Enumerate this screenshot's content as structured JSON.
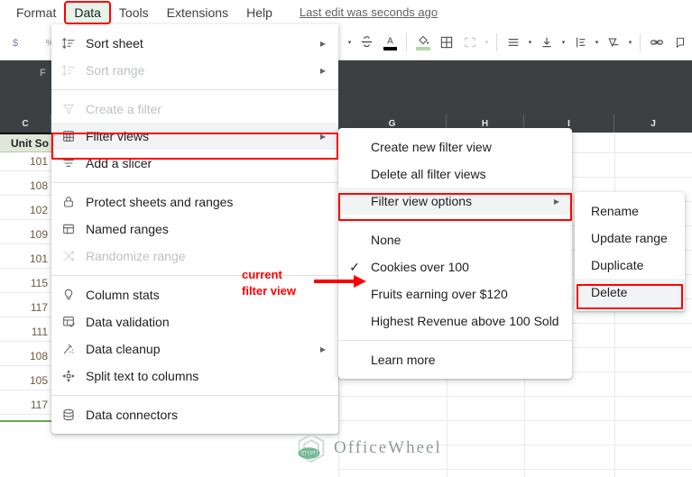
{
  "menubar": {
    "items": [
      {
        "label": "Format",
        "active": false
      },
      {
        "label": "Data",
        "active": true
      },
      {
        "label": "Tools",
        "active": false
      },
      {
        "label": "Extensions",
        "active": false
      },
      {
        "label": "Help",
        "active": false
      }
    ],
    "last_edit": "Last edit was seconds ago"
  },
  "toolbar": {
    "left_icons": [
      "currency-icon",
      "percent-icon",
      "decrease-decimal-icon"
    ],
    "right_icons": [
      "strikethrough-icon",
      "text-color-icon",
      "fill-color-icon",
      "borders-icon",
      "merge-cells-icon",
      "horizontal-align-icon",
      "vertical-align-icon",
      "text-wrap-icon",
      "text-rotation-icon",
      "insert-link-icon",
      "insert-comment-icon"
    ]
  },
  "sheet": {
    "formula_label": "F",
    "column_headers": [
      "C",
      "G",
      "H",
      "I",
      "J"
    ],
    "column_c": {
      "header": "Unit So",
      "values": [
        "101",
        "108",
        "102",
        "109",
        "101",
        "115",
        "117",
        "111",
        "108",
        "105",
        "117"
      ]
    }
  },
  "data_menu": {
    "items": [
      {
        "label": "Sort sheet",
        "icon": "sort-icon",
        "submenu": true,
        "disabled": false,
        "highlighted": false
      },
      {
        "label": "Sort range",
        "icon": "sort-icon",
        "submenu": true,
        "disabled": true,
        "highlighted": false
      },
      {
        "divider": true
      },
      {
        "label": "Create a filter",
        "icon": "filter-icon",
        "submenu": false,
        "disabled": true,
        "highlighted": false
      },
      {
        "label": "Filter views",
        "icon": "filter-views-icon",
        "submenu": true,
        "disabled": false,
        "highlighted": true,
        "boxed": true
      },
      {
        "label": "Add a slicer",
        "icon": "slicer-icon",
        "submenu": false,
        "disabled": false,
        "highlighted": false
      },
      {
        "divider": true
      },
      {
        "label": "Protect sheets and ranges",
        "icon": "lock-icon",
        "submenu": false,
        "disabled": false,
        "highlighted": false
      },
      {
        "label": "Named ranges",
        "icon": "named-ranges-icon",
        "submenu": false,
        "disabled": false,
        "highlighted": false
      },
      {
        "label": "Randomize range",
        "icon": "randomize-icon",
        "submenu": false,
        "disabled": true,
        "highlighted": false
      },
      {
        "divider": true
      },
      {
        "label": "Column stats",
        "icon": "column-stats-icon",
        "submenu": false,
        "disabled": false,
        "highlighted": false
      },
      {
        "label": "Data validation",
        "icon": "data-validation-icon",
        "submenu": false,
        "disabled": false,
        "highlighted": false
      },
      {
        "label": "Data cleanup",
        "icon": "data-cleanup-icon",
        "submenu": true,
        "disabled": false,
        "highlighted": false
      },
      {
        "label": "Split text to columns",
        "icon": "split-text-icon",
        "submenu": false,
        "disabled": false,
        "highlighted": false
      },
      {
        "divider": true
      },
      {
        "label": "Data connectors",
        "icon": "data-connectors-icon",
        "submenu": false,
        "disabled": false,
        "highlighted": false
      }
    ]
  },
  "filter_views_submenu": {
    "items": [
      {
        "label": "Create new filter view",
        "checked": false,
        "submenu": false,
        "highlighted": false
      },
      {
        "label": "Delete all filter views",
        "checked": false,
        "submenu": false,
        "highlighted": false
      },
      {
        "label": "Filter view options",
        "checked": false,
        "submenu": true,
        "highlighted": true,
        "boxed": true
      },
      {
        "divider": true
      },
      {
        "label": "None",
        "checked": false,
        "submenu": false,
        "highlighted": false
      },
      {
        "label": "Cookies over 100",
        "checked": true,
        "submenu": false,
        "highlighted": false
      },
      {
        "label": "Fruits earning over $120",
        "checked": false,
        "submenu": false,
        "highlighted": false
      },
      {
        "label": "Highest Revenue above 100 Sold",
        "checked": false,
        "submenu": false,
        "highlighted": false
      },
      {
        "divider": true
      },
      {
        "label": "Learn more",
        "checked": false,
        "submenu": false,
        "highlighted": false
      }
    ]
  },
  "filter_view_options_submenu": {
    "items": [
      {
        "label": "Rename",
        "highlighted": false,
        "boxed": false
      },
      {
        "label": "Update range",
        "highlighted": false,
        "boxed": false
      },
      {
        "label": "Duplicate",
        "highlighted": false,
        "boxed": false
      },
      {
        "label": "Delete",
        "highlighted": true,
        "boxed": true
      }
    ]
  },
  "annotation": {
    "line1": "current",
    "line2": "filter view",
    "color": "#ff0000"
  },
  "watermark": {
    "text": "OfficeWheel"
  },
  "colors": {
    "highlight_red": "#ff0000",
    "menu_hover": "#f1f3f4",
    "active_menu_bg": "#e6f4ea",
    "header_dark": "#3c4043",
    "cell_green": "#dfe8d8"
  }
}
